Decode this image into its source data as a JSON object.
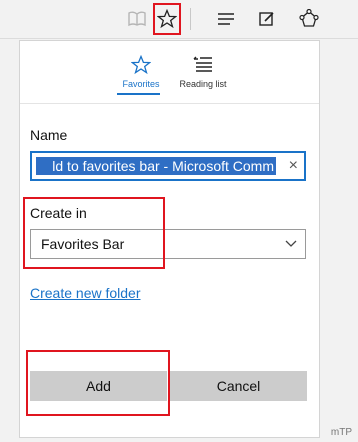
{
  "toolbar": {
    "icons": [
      "reading-view-icon",
      "favorites-star-icon",
      "hub-icon",
      "web-note-icon",
      "share-icon"
    ]
  },
  "panel": {
    "tabs": [
      {
        "label": "Favorites",
        "icon": "star-icon",
        "active": true
      },
      {
        "label": "Reading list",
        "icon": "reading-list-icon",
        "active": false
      }
    ],
    "name_label": "Name",
    "name_value": "ld to favorites bar - Microsoft Comm",
    "create_in_label": "Create in",
    "create_in_value": "Favorites Bar",
    "create_new_folder": "Create new folder",
    "add_button": "Add",
    "cancel_button": "Cancel"
  },
  "watermark": "mTP",
  "colors": {
    "accent": "#1a73c8",
    "highlight": "#e0151f",
    "selection": "#2f6ec4"
  }
}
